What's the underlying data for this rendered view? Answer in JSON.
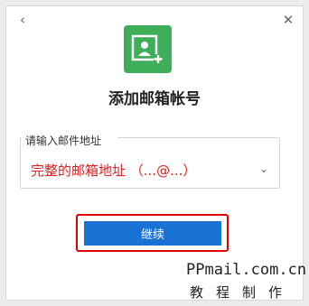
{
  "dialog": {
    "title": "添加邮箱帐号",
    "back_icon": "‹",
    "close_icon": "✕"
  },
  "email_field": {
    "label": "请输入邮件地址",
    "value": "完整的邮箱地址 （...@...）",
    "chevron": "⌄"
  },
  "continue_button": {
    "label": "继续"
  },
  "watermark": {
    "line1": "PPmail.com.cn",
    "line2": "教程制作"
  },
  "colors": {
    "logo": "#3fae5a",
    "button": "#1a73d4",
    "highlight": "#e00000",
    "field_value": "#e02020"
  }
}
